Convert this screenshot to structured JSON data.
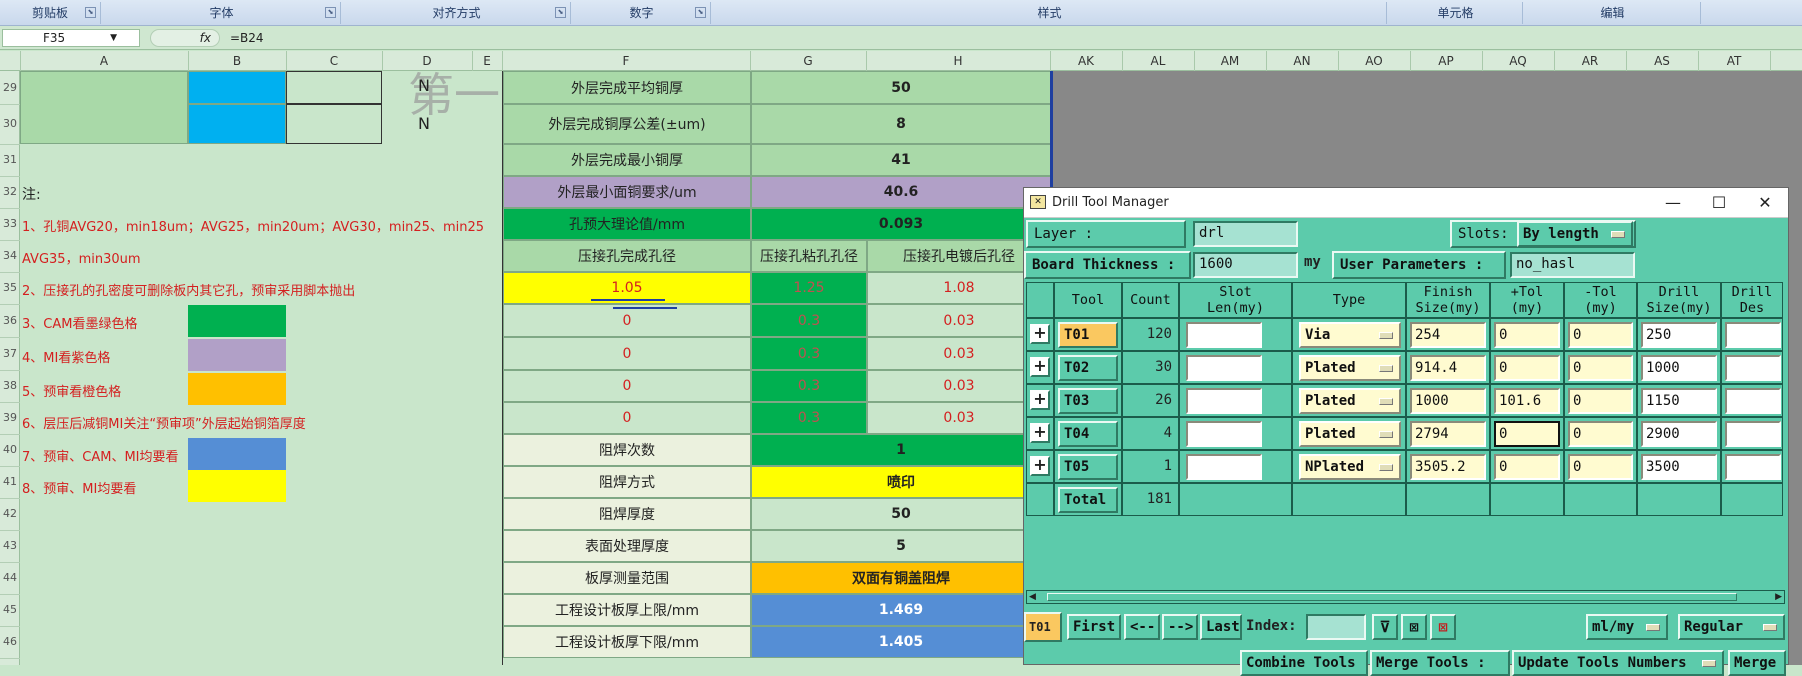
{
  "ribbon": {
    "groups": [
      "剪贴板",
      "字体",
      "对齐方式",
      "数字",
      "样式",
      "单元格",
      "编辑"
    ]
  },
  "formula_bar": {
    "name_box": "F35",
    "fx": "fx",
    "formula": "=B24"
  },
  "columns": [
    "A",
    "B",
    "C",
    "D",
    "E",
    "F",
    "G",
    "H",
    "AK",
    "AL",
    "AM",
    "AN",
    "AO",
    "AP",
    "AQ",
    "AR",
    "AS",
    "AT"
  ],
  "rows": [
    "29",
    "30",
    "31",
    "32",
    "33",
    "34",
    "35",
    "36",
    "37",
    "38",
    "39",
    "40",
    "41",
    "42",
    "43",
    "44",
    "45",
    "46"
  ],
  "left_block": {
    "d_values": [
      "N",
      "N"
    ],
    "watermark": "第一页"
  },
  "notes": [
    "注:",
    "1、孔铜AVG20，min18um；AVG25，min20um；AVG30，min25、min25",
    "AVG35，min30um",
    "2、压接孔的孔密度可删除板内其它孔，预审采用脚本抛出",
    "3、CAM看墨绿色格",
    "4、MI看紫色格",
    "5、预审看橙色格",
    "6、层压后减铜MI关注“预审项”外层起始铜箔厚度",
    "7、预审、CAM、MI均要看",
    "8、预审、MI均要看"
  ],
  "colors": {
    "dark_green": "#00b050",
    "purple": "#b1a0c7",
    "orange": "#ffc000",
    "blue": "#558ed5",
    "yellow": "#ffff00",
    "light_blue": "#00b0f0",
    "light_green": "#a9d9a8",
    "dtm_bg": "#5ccbab"
  },
  "sheet": {
    "rows_a": [
      {
        "label": "外层完成平均铜厚",
        "value": "50"
      },
      {
        "label": "外层完成铜厚公差(±um)",
        "value": "8"
      },
      {
        "label": "外层完成最小铜厚",
        "value": "41"
      },
      {
        "label": "外层最小面铜要求/um",
        "value": "40.6"
      },
      {
        "label": "孔预大理论值/mm",
        "value": "0.093"
      }
    ],
    "press_header": [
      "压接孔完成孔径",
      "压接孔粘孔孔径",
      "压接孔电镀后孔径"
    ],
    "press_rows": [
      [
        "1.05",
        "1.25",
        "1.08"
      ],
      [
        "0",
        "0.3",
        "0.03"
      ],
      [
        "0",
        "0.3",
        "0.03"
      ],
      [
        "0",
        "0.3",
        "0.03"
      ],
      [
        "0",
        "0.3",
        "0.03"
      ]
    ],
    "rows_b": [
      {
        "label": "阻焊次数",
        "value": "1"
      },
      {
        "label": "阻焊方式",
        "value": "喷印"
      },
      {
        "label": "阻焊厚度",
        "value": "50"
      },
      {
        "label": "表面处理厚度",
        "value": "5"
      },
      {
        "label": "板厚测量范围",
        "value": "双面有铜盖阻焊"
      },
      {
        "label": "工程设计板厚上限/mm",
        "value": "1.469"
      },
      {
        "label": "工程设计板厚下限/mm",
        "value": "1.405"
      }
    ]
  },
  "dtm": {
    "title": "Drill Tool Manager",
    "layer_label": "Layer           :",
    "layer_value": "drl",
    "slots_label": "Slots:",
    "slots_value": "By length",
    "board_thickness_label": "Board Thickness :",
    "board_thickness_value": "1600",
    "unit": "my",
    "user_params_label": "User Parameters :",
    "user_params_value": "no_hasl",
    "headers": [
      "Tool",
      "Count",
      "Slot\nLen(my)",
      "Type",
      "Finish\nSize(my)",
      "+Tol\n(my)",
      "-Tol\n(my)",
      "Drill\nSize(my)",
      "Drill\nDes"
    ],
    "tools": [
      {
        "tool": "T01",
        "count": "120",
        "slot": "",
        "type": "Via",
        "finish": "254",
        "ptol": "0",
        "ntol": "0",
        "drill": "250",
        "des": ""
      },
      {
        "tool": "T02",
        "count": "30",
        "slot": "",
        "type": "Plated",
        "finish": "914.4",
        "ptol": "0",
        "ntol": "0",
        "drill": "1000",
        "des": ""
      },
      {
        "tool": "T03",
        "count": "26",
        "slot": "",
        "type": "Plated",
        "finish": "1000",
        "ptol": "101.6",
        "ntol": "0",
        "drill": "1150",
        "des": ""
      },
      {
        "tool": "T04",
        "count": "4",
        "slot": "",
        "type": "Plated",
        "finish": "2794",
        "ptol": "0",
        "ntol": "0",
        "drill": "2900",
        "des": ""
      },
      {
        "tool": "T05",
        "count": "1",
        "slot": "",
        "type": "NPlated",
        "finish": "3505.2",
        "ptol": "0",
        "ntol": "0",
        "drill": "3500",
        "des": ""
      }
    ],
    "total_label": "Total",
    "total_count": "181",
    "current_tool": "T01",
    "nav": {
      "first": "First",
      "prev": "<--",
      "next": "-->",
      "last": "Last",
      "index": "Index:"
    },
    "units_option": "ml/my",
    "mode_option": "Regular",
    "bottom_buttons": [
      "Combine Tools",
      "Merge Tools :",
      "Update Tools Numbers",
      "Merge"
    ]
  }
}
